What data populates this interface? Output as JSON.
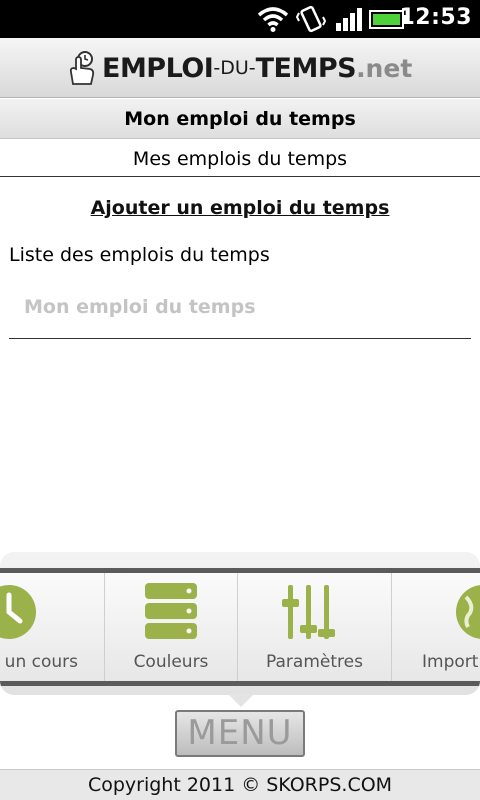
{
  "status_bar": {
    "time": "12:53",
    "icons": [
      "wifi-icon",
      "vibrate-icon",
      "signal-icon",
      "battery-icon"
    ]
  },
  "header": {
    "logo_part1": "EMPLOI",
    "logo_part2": "-DU-",
    "logo_part3": "TEMPS",
    "logo_part4": ".net"
  },
  "section": {
    "title": "Mon emploi du temps",
    "subtitle": "Mes emplois du temps"
  },
  "content": {
    "add_link": "Ajouter un emploi du temps",
    "list_label": "Liste des emplois du temps",
    "items": [
      {
        "label": "Mon emploi du temps"
      }
    ]
  },
  "options_menu": {
    "items": [
      {
        "label": "un cours",
        "icon": "clock-icon"
      },
      {
        "label": "Couleurs",
        "icon": "color-stack-icon"
      },
      {
        "label": "Paramètres",
        "icon": "sliders-icon"
      },
      {
        "label": "Import",
        "icon": "globe-icon"
      }
    ],
    "menu_key_label": "MENU"
  },
  "footer": {
    "copyright": "Copyright 2011 © SKORPS.COM"
  },
  "colors": {
    "icon_green": "#9bb14a",
    "header_grey": "#dcdcdc",
    "placeholder_grey": "#c4c4c4"
  }
}
